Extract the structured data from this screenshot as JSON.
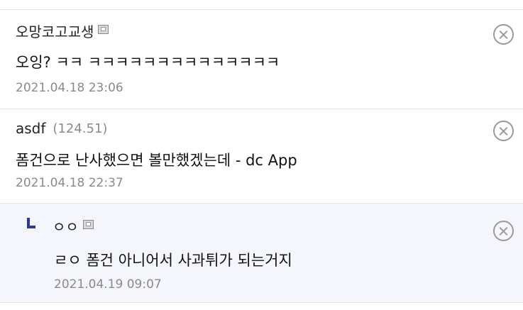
{
  "comments": [
    {
      "nickname": "오망코고교생",
      "ip": "",
      "has_gallog_icon": true,
      "text": "오잉? ㅋㅋ ㅋㅋㅋㅋㅋㅋㅋㅋㅋㅋㅋㅋㅋㅋ",
      "date": "2021.04.18 23:06"
    },
    {
      "nickname": "asdf",
      "ip": "(124.51)",
      "has_gallog_icon": false,
      "text": "폼건으로 난사했으면 볼만했겠는데 - dc App",
      "date": "2021.04.18 22:37"
    },
    {
      "nickname": "ㅇㅇ",
      "ip": "",
      "has_gallog_icon": true,
      "is_reply": true,
      "text": "ㄹㅇ 폼건 아니어서 사과튀가 되는거지",
      "date": "2021.04.19 09:07"
    }
  ],
  "icons": {
    "delete": "circle-x-icon",
    "gallog": "gallog-icon",
    "reply": "reply-arrow-icon"
  },
  "colors": {
    "reply_background": "#f4f6fb",
    "reply_mark": "#2b3b8f",
    "muted_text": "#8a8a8a",
    "divider": "#e6e6e6"
  }
}
